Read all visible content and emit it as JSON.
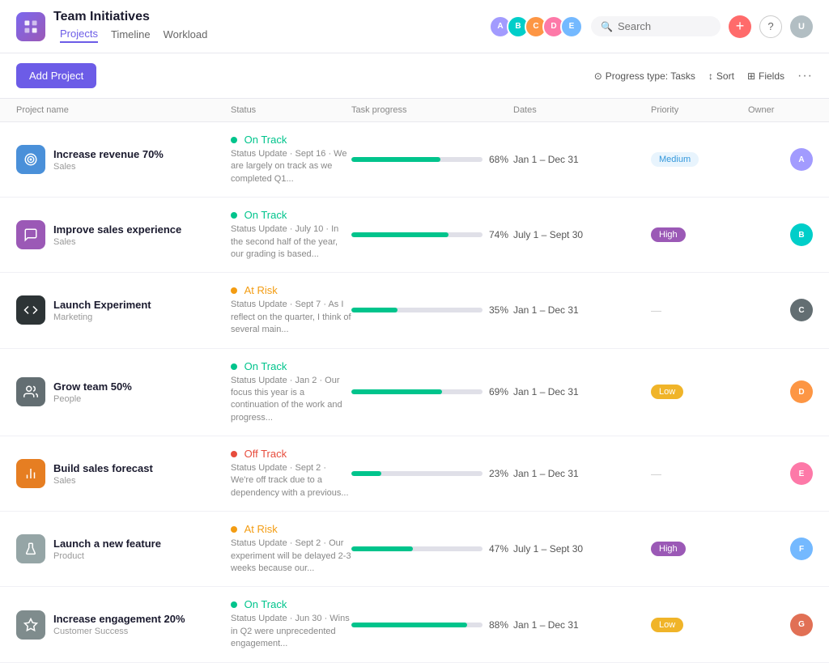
{
  "app": {
    "icon_label": "TI",
    "title": "Team Initiatives",
    "nav": [
      {
        "label": "Projects",
        "active": true
      },
      {
        "label": "Timeline",
        "active": false
      },
      {
        "label": "Workload",
        "active": false
      }
    ]
  },
  "toolbar": {
    "add_project_label": "Add Project",
    "progress_type_label": "Progress type: Tasks",
    "sort_label": "Sort",
    "fields_label": "Fields",
    "more_label": "···"
  },
  "table": {
    "headers": [
      "Project name",
      "Status",
      "Task progress",
      "Dates",
      "Priority",
      "Owner"
    ],
    "rows": [
      {
        "name": "Increase revenue 70%",
        "dept": "Sales",
        "icon_type": "target",
        "icon_color": "icon-blue",
        "status": "on-track",
        "status_label": "On Track",
        "status_update": "Status Update · Sept 16 · We are largely on track as we completed Q1...",
        "progress": 68,
        "dates": "Jan 1 – Dec 31",
        "priority": "Medium",
        "priority_type": "medium"
      },
      {
        "name": "Improve sales experience",
        "dept": "Sales",
        "icon_type": "chat",
        "icon_color": "icon-purple",
        "status": "on-track",
        "status_label": "On Track",
        "status_update": "Status Update · July 10 · In the second half of the year, our grading is based...",
        "progress": 74,
        "dates": "July 1 – Sept 30",
        "priority": "High",
        "priority_type": "high"
      },
      {
        "name": "Launch Experiment",
        "dept": "Marketing",
        "icon_type": "code",
        "icon_color": "icon-dark",
        "status": "at-risk",
        "status_label": "At Risk",
        "status_update": "Status Update · Sept 7 · As I reflect on the quarter, I think of several main...",
        "progress": 35,
        "dates": "Jan 1 – Dec 31",
        "priority": "—",
        "priority_type": "none"
      },
      {
        "name": "Grow team 50%",
        "dept": "People",
        "icon_type": "people",
        "icon_color": "icon-gray",
        "status": "on-track",
        "status_label": "On Track",
        "status_update": "Status Update · Jan 2 · Our focus this year is a continuation of the work and progress...",
        "progress": 69,
        "dates": "Jan 1 – Dec 31",
        "priority": "Low",
        "priority_type": "low"
      },
      {
        "name": "Build sales forecast",
        "dept": "Sales",
        "icon_type": "bars",
        "icon_color": "icon-orange",
        "status": "off-track",
        "status_label": "Off Track",
        "status_update": "Status Update · Sept 2 · We're off track due to a dependency with a previous...",
        "progress": 23,
        "dates": "Jan 1 – Dec 31",
        "priority": "—",
        "priority_type": "none"
      },
      {
        "name": "Launch a new feature",
        "dept": "Product",
        "icon_type": "flask",
        "icon_color": "icon-light-gray",
        "status": "at-risk",
        "status_label": "At Risk",
        "status_update": "Status Update · Sept 2 · Our experiment will be delayed 2-3 weeks because our...",
        "progress": 47,
        "dates": "July 1 – Sept 30",
        "priority": "High",
        "priority_type": "high"
      },
      {
        "name": "Increase engagement 20%",
        "dept": "Customer Success",
        "icon_type": "star",
        "icon_color": "icon-star-gray",
        "status": "on-track",
        "status_label": "On Track",
        "status_update": "Status Update · Jun 30 · Wins in Q2 were unprecedented engagement...",
        "progress": 88,
        "dates": "Jan 1 – Dec 31",
        "priority": "Low",
        "priority_type": "low"
      }
    ]
  },
  "search": {
    "placeholder": "Search"
  }
}
